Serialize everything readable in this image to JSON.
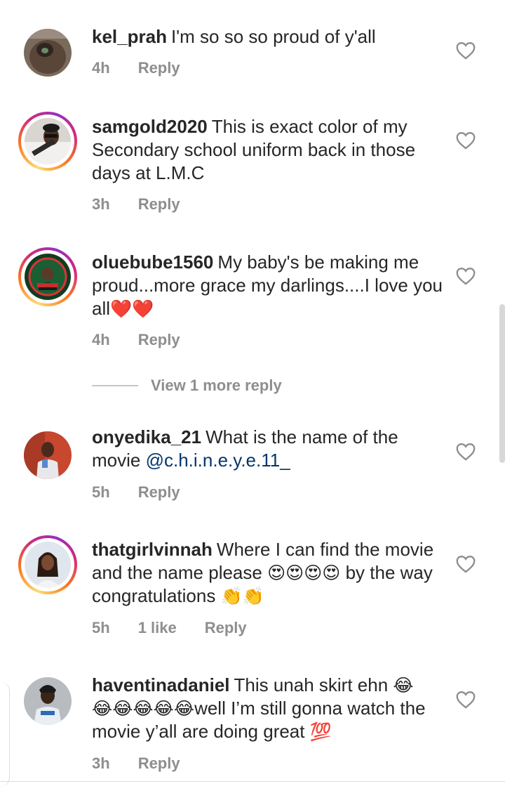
{
  "comments": [
    {
      "username": "kel_prah",
      "text": "I'm so so so proud of y'all",
      "time": "4h",
      "reply": "Reply",
      "likes": ""
    },
    {
      "username": "samgold2020",
      "text": "This is exact color of my Secondary school uniform back in those days at L.M.C",
      "time": "3h",
      "reply": "Reply",
      "likes": ""
    },
    {
      "username": "oluebube1560",
      "text": "My baby's be making me proud...more grace my darlings....I love you all",
      "emoji": "❤️❤️",
      "time": "4h",
      "reply": "Reply",
      "likes": ""
    },
    {
      "username": "onyedika_21",
      "text": "What is the name of the movie",
      "mention": "@c.h.i.n.e.y.e.11_",
      "time": "5h",
      "reply": "Reply",
      "likes": ""
    },
    {
      "username": "thatgirlvinnah",
      "text": "Where I can find the movie and the name please",
      "emoji": "😍😍😍😍",
      "text2": "by the way congratulations",
      "emoji2": "👏👏",
      "time": "5h",
      "likes": "1 like",
      "reply": "Reply"
    },
    {
      "username": "haventinadaniel",
      "text": "This unah skirt ehn",
      "emoji": "😂",
      "emoji_b": "😂😂😂😂😂",
      "text2": "well I’m still gonna watch the movie y’all are doing great",
      "emoji2": "💯",
      "time": "3h",
      "reply": "Reply",
      "likes": ""
    }
  ],
  "view_more": "View 1 more reply",
  "colors": {
    "text": "#262626",
    "meta": "#8e8e8e",
    "mention": "#00376b",
    "heart": "#8e8e8e"
  },
  "icons": {
    "like": "heart-outline-icon"
  }
}
